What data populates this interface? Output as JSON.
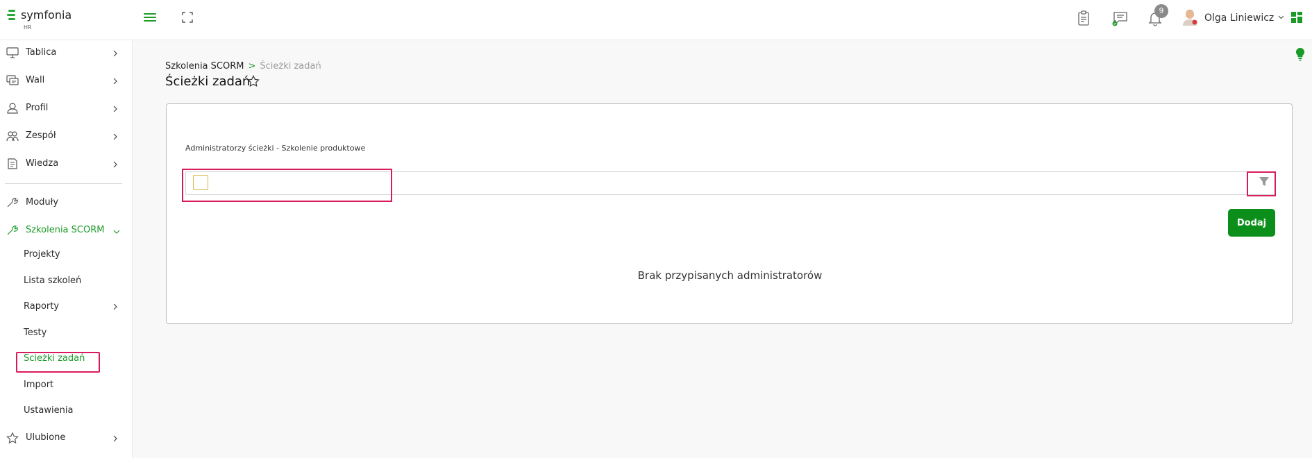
{
  "brand": {
    "name": "symfonia",
    "sub": "HR",
    "accent": "#1a9b27"
  },
  "header": {
    "icons": [
      "hamburger-icon",
      "fullscreen-icon",
      "clipboard-icon",
      "chat-icon",
      "bell-icon"
    ],
    "notification_count": "9",
    "user_name": "Olga Liniewicz"
  },
  "sidebar": {
    "items": [
      {
        "label": "Tablica",
        "icon": "monitor-icon"
      },
      {
        "label": "Wall",
        "icon": "wall-icon"
      },
      {
        "label": "Profil",
        "icon": "user-icon"
      },
      {
        "label": "Zespół",
        "icon": "team-icon"
      },
      {
        "label": "Wiedza",
        "icon": "document-icon"
      },
      {
        "label": "Moduły",
        "icon": "wrench-icon"
      },
      {
        "label": "Szkolenia SCORM",
        "icon": "wrench-icon"
      }
    ],
    "subitems": [
      {
        "label": "Projekty"
      },
      {
        "label": "Lista szkoleń"
      },
      {
        "label": "Raporty"
      },
      {
        "label": "Testy"
      },
      {
        "label": "Ścieżki zadań"
      },
      {
        "label": "Import"
      },
      {
        "label": "Ustawienia"
      }
    ],
    "favorites": {
      "label": "Ulubione",
      "icon": "star-icon"
    }
  },
  "breadcrumb": {
    "parent": "Szkolenia SCORM",
    "separator": ">",
    "current": "Ścieżki zadań"
  },
  "page": {
    "title": "Ścieżki zadań"
  },
  "card": {
    "label": "Administratorzy ścieżki - Szkolenie produktowe",
    "add_button": "Dodaj",
    "empty_text": "Brak przypisanych administratorów"
  }
}
